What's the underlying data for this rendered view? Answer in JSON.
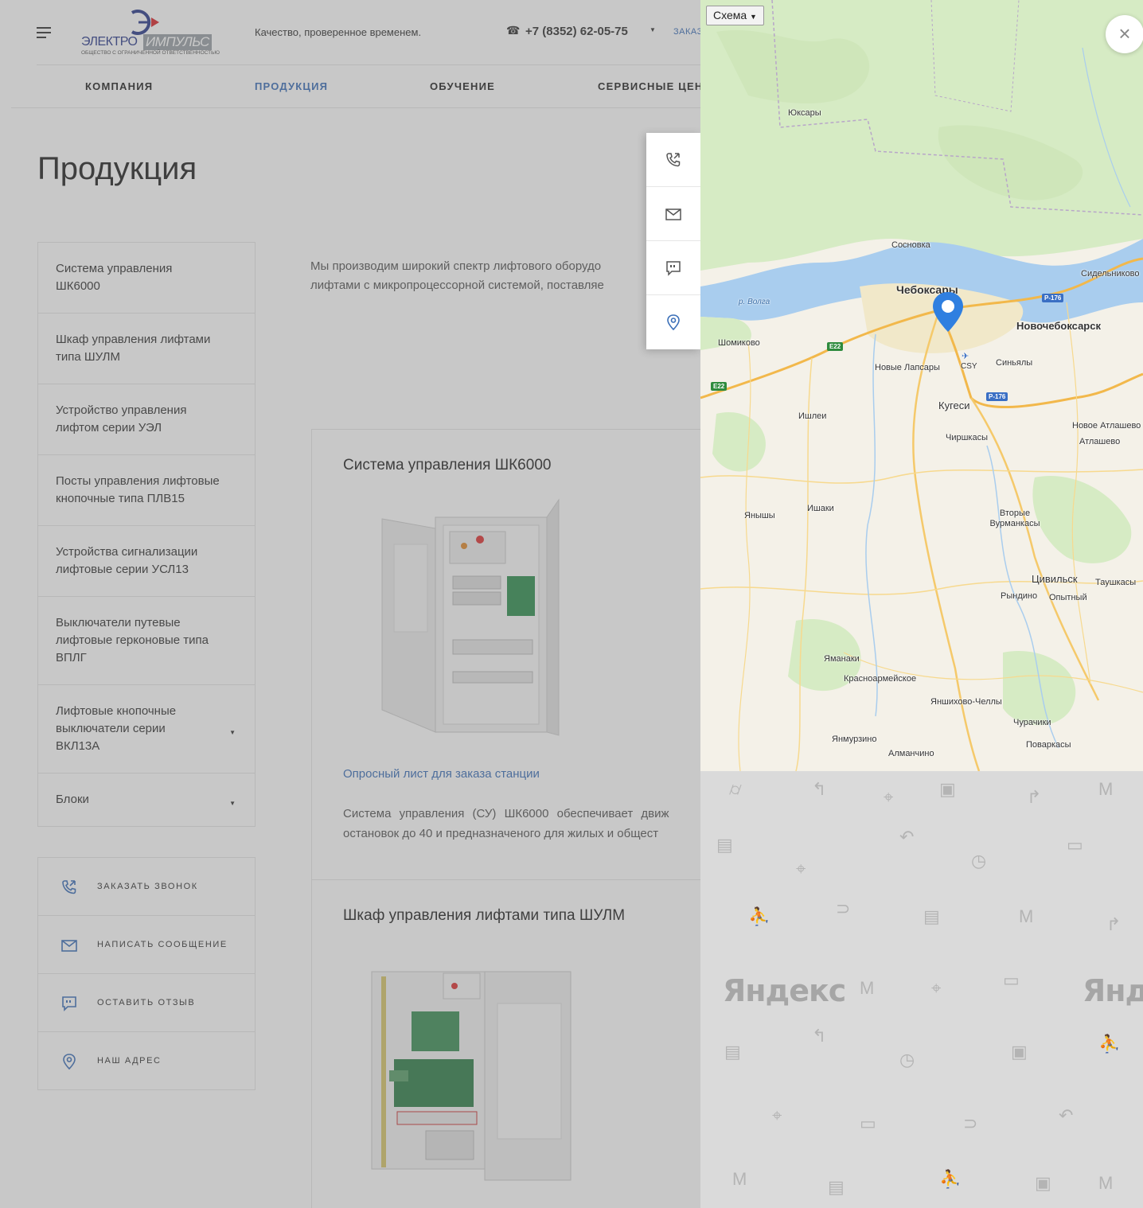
{
  "header": {
    "logo": {
      "word_a": "ЭЛЕКТРО",
      "word_b": "ИМПУЛЬС",
      "sub": "ОБЩЕСТВО С ОГРАНИЧЕННОЙ ОТВЕТСТВЕННОСТЬЮ"
    },
    "slogan": "Качество, проверенное временем.",
    "phone": "+7 (8352) 62-05-75",
    "order_link": "ЗАКАЗ"
  },
  "nav": {
    "items": [
      {
        "label": "КОМПАНИЯ",
        "active": false
      },
      {
        "label": "ПРОДУКЦИЯ",
        "active": true
      },
      {
        "label": "ОБУЧЕНИЕ",
        "active": false
      },
      {
        "label": "СЕРВИСНЫЕ ЦЕН",
        "active": false
      }
    ]
  },
  "page_title": "Продукция",
  "sidemenu": {
    "items": [
      {
        "label": "Система управления ШК6000",
        "has_children": false
      },
      {
        "label": "Шкаф управления лифтами типа ШУЛМ",
        "has_children": false
      },
      {
        "label": "Устройство управления лифтом серии УЭЛ",
        "has_children": false
      },
      {
        "label": "Посты управления лифтовые кнопочные типа ПЛВ15",
        "has_children": false
      },
      {
        "label": "Устройства сигнализации лифтовые серии УСЛ13",
        "has_children": false
      },
      {
        "label": "Выключатели путевые лифтовые герконовые типа ВПЛГ",
        "has_children": false
      },
      {
        "label": "Лифтовые кнопочные выключатели серии ВКЛ13А",
        "has_children": true
      },
      {
        "label": "Блоки",
        "has_children": true
      }
    ]
  },
  "contacts": {
    "call": "ЗАКАЗАТЬ ЗВОНОК",
    "message": "НАПИСАТЬ СООБЩЕНИЕ",
    "review": "ОСТАВИТЬ ОТЗЫВ",
    "address": "НАШ АДРЕС"
  },
  "intro": {
    "line1": "Мы производим широкий спектр лифтового оборудо",
    "line2": "лифтами с микропроцессорной системой, поставляе"
  },
  "products": [
    {
      "title": "Система управления ШК6000",
      "link": "Опросный лист для заказа станции",
      "desc_line1": "Система управления (СУ) ШК6000 обеспечивает движ",
      "desc_line2": "остановок до 40 и предназначеного для жилых и общест"
    },
    {
      "title": "Шкаф управления лифтами типа ШУЛМ"
    }
  ],
  "map": {
    "layer_button": "Схема",
    "close": "×",
    "labels": {
      "yuksary": "Юксары",
      "sosnovka": "Сосновка",
      "cheboksary": "Чебоксары",
      "sidelnikovo": "Сидельниково",
      "volga": "р. Волга",
      "novocheboksarsk": "Новочебоксарск",
      "shomikovo": "Шомиково",
      "novye_lapsary": "Новые Лапсары",
      "csy": "CSY",
      "sinyaly": "Синьялы",
      "ishlei": "Ишлеи",
      "kugesi": "Кугеси",
      "novoe_atlashevo": "Новое Атлашево",
      "chirshkasy": "Чиршкасы",
      "atlashevo": "Атлашево",
      "ishaki": "Ишаки",
      "yanyshi": "Янышы",
      "vtorye_vurmankasy": "Вторые Вурманкасы",
      "tsivilsk": "Цивильск",
      "taushkasy": "Таушкасы",
      "ryndino": "Рындино",
      "opytny": "Опытный",
      "yamanaki": "Яманаки",
      "krasnoarmeyskoe": "Красноармейское",
      "yanshikhovo": "Яншихово-Челлы",
      "churachiki": "Чурачики",
      "yanmurzino": "Янмурзино",
      "almanchino": "Алманчино",
      "povarkasy": "Поваркасы"
    },
    "roads": {
      "p176_a": "Р-176",
      "p176_b": "Р-176",
      "e22_a": "E22",
      "e22_b": "E22"
    },
    "watermark": "Яндекс"
  },
  "colors": {
    "accent": "#3b6fb8",
    "pin": "#2f7fe0",
    "water": "#a9cdee",
    "forest": "#d6ebc4"
  }
}
